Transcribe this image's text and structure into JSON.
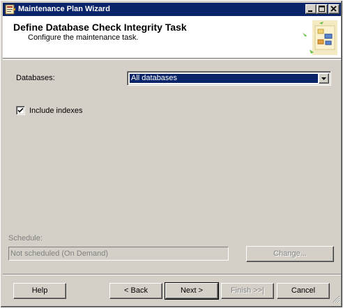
{
  "window": {
    "title": "Maintenance Plan Wizard"
  },
  "header": {
    "title": "Define Database Check Integrity Task",
    "subtitle": "Configure the maintenance task."
  },
  "form": {
    "databases_label": "Databases:",
    "databases_value": "All databases",
    "include_indexes_label": "Include indexes",
    "include_indexes_checked": true
  },
  "schedule": {
    "label": "Schedule:",
    "value": "Not scheduled (On Demand)",
    "change_label": "Change..."
  },
  "buttons": {
    "help": "Help",
    "back": "< Back",
    "next": "Next >",
    "finish": "Finish >>|",
    "cancel": "Cancel"
  },
  "colors": {
    "titlebar": "#0a246a",
    "selection": "#0a246a",
    "face": "#d4d0c8"
  },
  "icons": {
    "title": "wizard-app-icon",
    "header": "wizard-graphic-icon",
    "minimize": "minimize-icon",
    "maximize": "maximize-icon",
    "close": "close-icon",
    "dropdown": "chevron-down-icon",
    "check": "checkmark-icon",
    "grip": "resize-grip-icon"
  }
}
